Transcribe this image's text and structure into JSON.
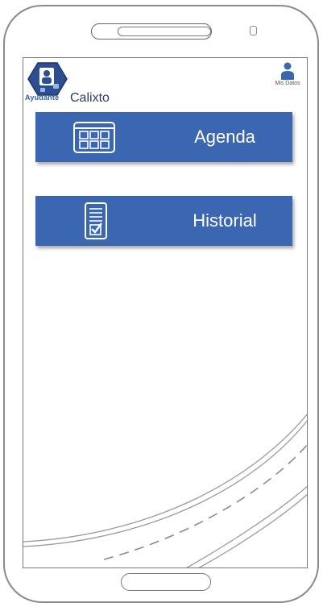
{
  "app": {
    "brand_small": "Ayudante",
    "user_name": "Calixto"
  },
  "profile": {
    "label": "Mis Datos",
    "icon": "person-icon"
  },
  "menu": {
    "agenda_label": "Agenda",
    "agenda_icon": "calendar-grid-icon",
    "historial_label": "Historial",
    "historial_icon": "checklist-icon"
  },
  "colors": {
    "tile": "#3b67b2",
    "brand": "#2f5fa7",
    "logo_hex": "#2d4f92"
  }
}
